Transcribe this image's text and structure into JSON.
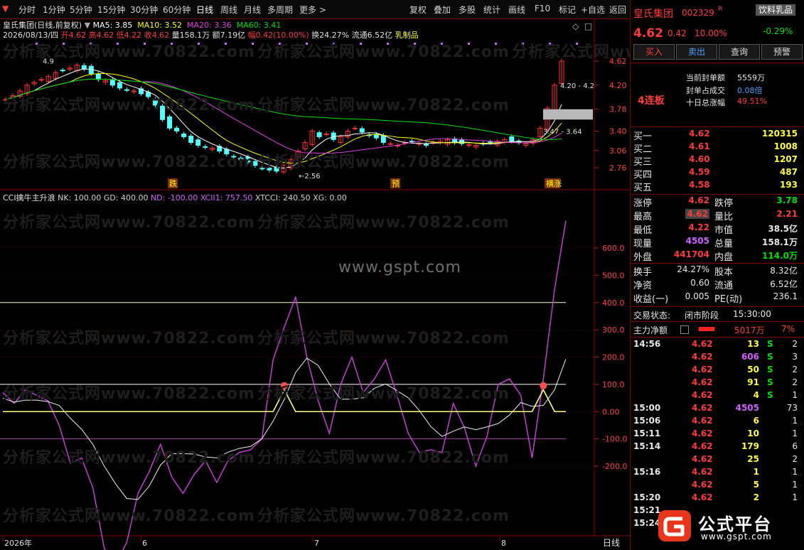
{
  "toolbar": {
    "items": [
      "分时",
      "1分钟",
      "5分钟",
      "15分钟",
      "30分钟",
      "60分钟",
      "日线",
      "周线",
      "月线",
      "多周期",
      "更多 >"
    ],
    "right_items": [
      "复权",
      "叠加",
      "多股",
      "统计",
      "画线",
      "F10",
      "标记",
      "+自选",
      "返回"
    ]
  },
  "main_chart": {
    "title": "皇氏集团(日线,前复权)",
    "ma_labels": [
      {
        "text": "MA5: 3.85",
        "color": "#ffffff"
      },
      {
        "text": "MA10: 3.52",
        "color": "#ffff00"
      },
      {
        "text": "MA20: 3.36",
        "color": "#e040e0"
      },
      {
        "text": "MA60: 3.41",
        "color": "#00e000"
      }
    ],
    "bar_info": {
      "date": "2026/08/13/四",
      "open": "开4.62",
      "high": "高4.62",
      "low": "低4.22",
      "close": "收4.62",
      "volume": "量158.1万",
      "amount": "额7.19亿",
      "change": "幅0.42(10.00%)",
      "turnover": "换24.27%",
      "float_cap": "流通6.52亿",
      "sector": "乳制品"
    },
    "price_ticks": [
      "4.62",
      "4.20",
      "3.78",
      "3.40",
      "3.06",
      "2.76"
    ],
    "annotations": {
      "high": "4.9",
      "low": "2.56",
      "box_high": "4.20 - 4.2",
      "box_low": "3.47 - 3.64"
    },
    "markers": [
      "跌",
      "预",
      "横涨"
    ]
  },
  "indicator": {
    "name": "CCI擒牛主升浪",
    "params": [
      {
        "text": "NK: 100.00",
        "color": "#d0d0d0"
      },
      {
        "text": "GD: 400.00",
        "color": "#d0d0d0"
      },
      {
        "text": "ND: -100.00",
        "color": "#d060ff"
      },
      {
        "text": "XCII1: 757.50",
        "color": "#d060ff"
      },
      {
        "text": "XTCCI: 240.50",
        "color": "#d0d0d0"
      },
      {
        "text": "XG: 0.00",
        "color": "#d0d0d0"
      }
    ],
    "ticks": [
      "600.0",
      "500.0",
      "400.0",
      "300.0",
      "200.0",
      "100.0",
      "0.00",
      "-100.0",
      "-200.0"
    ]
  },
  "time_axis": {
    "labels": [
      "2026年",
      "6",
      "7",
      "8"
    ],
    "period": "日线"
  },
  "watermarks": [
    "分析家公式网www.70822.com",
    "www.gspt.com"
  ],
  "quote": {
    "name": "皇氏集团",
    "code": "002329",
    "flag": "R",
    "sector": "饮料乳品",
    "sector_change": "-0.29%",
    "price": "4.62",
    "change": "0.42",
    "pct": "10.00%",
    "buttons": [
      "买入",
      "卖出",
      "查询",
      "预警"
    ],
    "limit_label": "4连板",
    "seal_amount_label": "当前封单额",
    "seal_amount": "5559万",
    "seal_ratio_label": "封单占成交",
    "seal_ratio": "0.08倍",
    "ten_day_label": "十日总涨幅",
    "ten_day": "49.51%",
    "bids": [
      {
        "label": "买一",
        "price": "4.62",
        "vol": "120315"
      },
      {
        "label": "买二",
        "price": "4.61",
        "vol": "1008"
      },
      {
        "label": "买三",
        "price": "4.60",
        "vol": "1207"
      },
      {
        "label": "买四",
        "price": "4.59",
        "vol": "487"
      },
      {
        "label": "买五",
        "price": "4.58",
        "vol": "193"
      }
    ],
    "stats": [
      {
        "l1": "涨停",
        "v1": "4.62",
        "c1": "red",
        "l2": "跌停",
        "v2": "3.78",
        "c2": "green"
      },
      {
        "l1": "最高",
        "v1": "4.62",
        "c1": "red",
        "l2": "量比",
        "v2": "2.21",
        "c2": "red"
      },
      {
        "l1": "最低",
        "v1": "4.22",
        "c1": "red",
        "l2": "市值",
        "v2": "38.5亿",
        "c2": "white"
      },
      {
        "l1": "现量",
        "v1": "4505",
        "c1": "purple",
        "l2": "总量",
        "v2": "158.1万",
        "c2": "white"
      },
      {
        "l1": "外盘",
        "v1": "441704",
        "c1": "red",
        "l2": "内盘",
        "v2": "114.0万",
        "c2": "green"
      }
    ],
    "stats2": [
      {
        "l1": "换手",
        "v1": "24.27%",
        "l2": "股本",
        "v2": "8.32亿"
      },
      {
        "l1": "净资",
        "v1": "0.60",
        "l2": "流通",
        "v2": "6.52亿"
      },
      {
        "l1": "收益(一)",
        "v1": "0.005",
        "l2": "PE(动)",
        "v2": "236.1"
      }
    ],
    "trade_status_label": "交易状态:",
    "trade_status": "闭市阶段",
    "trade_time": "15:30:00",
    "net_flow_label": "主力净额",
    "net_flow": "5017万",
    "net_flow_pct": "7%",
    "ticks": [
      {
        "time": "14:56",
        "price": "4.62",
        "vol": "13",
        "vc": "yellow",
        "side": "S",
        "n": "2"
      },
      {
        "time": "",
        "price": "4.62",
        "vol": "606",
        "vc": "purple",
        "side": "S",
        "n": "3"
      },
      {
        "time": "",
        "price": "4.62",
        "vol": "50",
        "vc": "yellow",
        "side": "S",
        "n": "2"
      },
      {
        "time": "",
        "price": "4.62",
        "vol": "91",
        "vc": "yellow",
        "side": "S",
        "n": "2"
      },
      {
        "time": "",
        "price": "4.62",
        "vol": "4",
        "vc": "yellow",
        "side": "S",
        "n": "1"
      },
      {
        "time": "15:00",
        "price": "4.62",
        "vol": "4505",
        "vc": "purple",
        "side": "",
        "n": "73"
      },
      {
        "time": "15:06",
        "price": "4.62",
        "vol": "6",
        "vc": "yellow",
        "side": "",
        "n": "1"
      },
      {
        "time": "15:11",
        "price": "4.62",
        "vol": "10",
        "vc": "yellow",
        "side": "",
        "n": "1"
      },
      {
        "time": "15:14",
        "price": "4.62",
        "vol": "179",
        "vc": "yellow",
        "side": "",
        "n": "6"
      },
      {
        "time": "",
        "price": "4.62",
        "vol": "25",
        "vc": "yellow",
        "side": "",
        "n": "2"
      },
      {
        "time": "15:16",
        "price": "4.62",
        "vol": "1",
        "vc": "yellow",
        "side": "",
        "n": "1"
      },
      {
        "time": "",
        "price": "4.62",
        "vol": "5",
        "vc": "yellow",
        "side": "",
        "n": "1"
      },
      {
        "time": "15:20",
        "price": "4.62",
        "vol": "2",
        "vc": "yellow",
        "side": "",
        "n": "1"
      },
      {
        "time": "15:21",
        "price": "",
        "vol": "",
        "vc": "yellow",
        "side": "",
        "n": ""
      },
      {
        "time": "15:24",
        "price": "",
        "vol": "",
        "vc": "yellow",
        "side": "",
        "n": ""
      }
    ],
    "brand": {
      "text": "公式平台",
      "url_text": "www.gspt.com"
    }
  }
}
